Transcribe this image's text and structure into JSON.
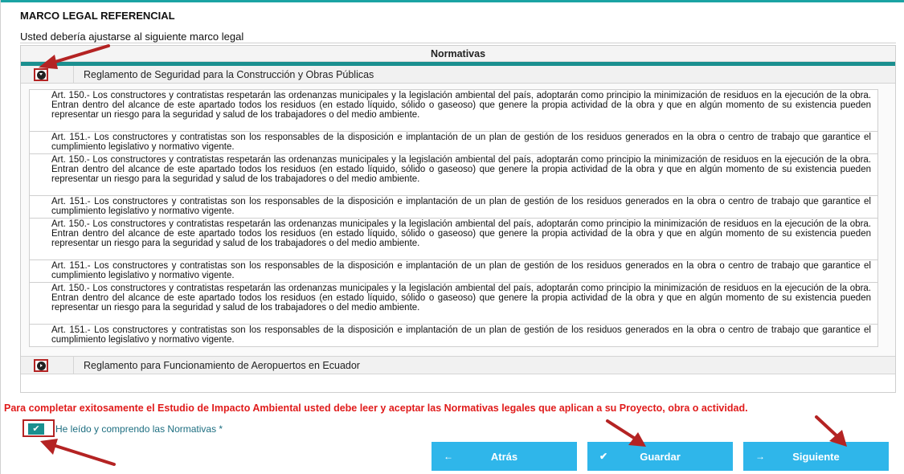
{
  "header": {
    "title": "MARCO LEGAL REFERENCIAL",
    "subtitle": "Usted debería ajustarse al siguiente marco legal"
  },
  "panel": {
    "title": "Normativas",
    "accordions": [
      {
        "label": "Reglamento de Seguridad para la Construcción y Obras Públicas",
        "expanded": true
      },
      {
        "label": "Reglamento para Funcionamiento de Aeropuertos en Ecuador",
        "expanded": false
      }
    ],
    "articles": [
      "Art. 150.- Los constructores y contratistas respetarán las ordenanzas municipales y la legislación ambiental del país, adoptarán como principio la minimización de residuos en la ejecución de la obra. Entran dentro del alcance de este apartado todos los residuos (en estado líquido, sólido o gaseoso) que genere la propia actividad de la obra y que en algún momento de su existencia pueden representar un riesgo para la seguridad y salud de los trabajadores o del medio ambiente.",
      "Art. 151.- Los constructores y contratistas son los responsables de la disposición e implantación de un plan de gestión de los residuos generados en la obra o centro de trabajo que garantice el cumplimiento legislativo y normativo vigente.",
      "Art. 150.- Los constructores y contratistas respetarán las ordenanzas municipales y la legislación ambiental del país, adoptarán como principio la minimización de residuos en la ejecución de la obra. Entran dentro del alcance de este apartado todos los residuos (en estado líquido, sólido o gaseoso) que genere la propia actividad de la obra y que en algún momento de su existencia pueden representar un riesgo para la seguridad y salud de los trabajadores o del medio ambiente.",
      "Art. 151.- Los constructores y contratistas son los responsables de la disposición e implantación de un plan de gestión de los residuos generados en la obra o centro de trabajo que garantice el cumplimiento legislativo y normativo vigente.",
      "Art. 150.- Los constructores y contratistas respetarán las ordenanzas municipales y la legislación ambiental del país, adoptarán como principio la minimización de residuos en la ejecución de la obra. Entran dentro del alcance de este apartado todos los residuos (en estado líquido, sólido o gaseoso) que genere la propia actividad de la obra y que en algún momento de su existencia pueden representar un riesgo para la seguridad y salud de los trabajadores o del medio ambiente.",
      "Art. 151.- Los constructores y contratistas son los responsables de la disposición e implantación de un plan de gestión de los residuos generados en la obra o centro de trabajo que garantice el cumplimiento legislativo y normativo vigente.",
      "Art. 150.- Los constructores y contratistas respetarán las ordenanzas municipales y la legislación ambiental del país, adoptarán como principio la minimización de residuos en la ejecución de la obra. Entran dentro del alcance de este apartado todos los residuos (en estado líquido, sólido o gaseoso) que genere la propia actividad de la obra y que en algún momento de su existencia pueden representar un riesgo para la seguridad y salud de los trabajadores o del medio ambiente.",
      "Art. 151.- Los constructores y contratistas son los responsables de la disposición e implantación de un plan de gestión de los residuos generados en la obra o centro de trabajo que garantice el cumplimiento legislativo y normativo vigente."
    ]
  },
  "warning": "Para completar exitosamente el Estudio de Impacto Ambiental usted debe leer y aceptar las Normativas legales que aplican a su Proyecto, obra o actividad.",
  "acceptance": {
    "checked": true,
    "label": "He leído y comprendo las Normativas *"
  },
  "buttons": {
    "back": {
      "label": "Atrás",
      "icon": "arrow-left-icon",
      "glyph": "←"
    },
    "save": {
      "label": "Guardar",
      "icon": "check-icon",
      "glyph": "✔"
    },
    "next": {
      "label": "Siguiente",
      "icon": "arrow-right-icon",
      "glyph": "→"
    }
  },
  "colors": {
    "teal": "#1a8f8f",
    "button": "#2fb6ea",
    "warning": "#e01b1b",
    "annotation": "#b42323"
  }
}
